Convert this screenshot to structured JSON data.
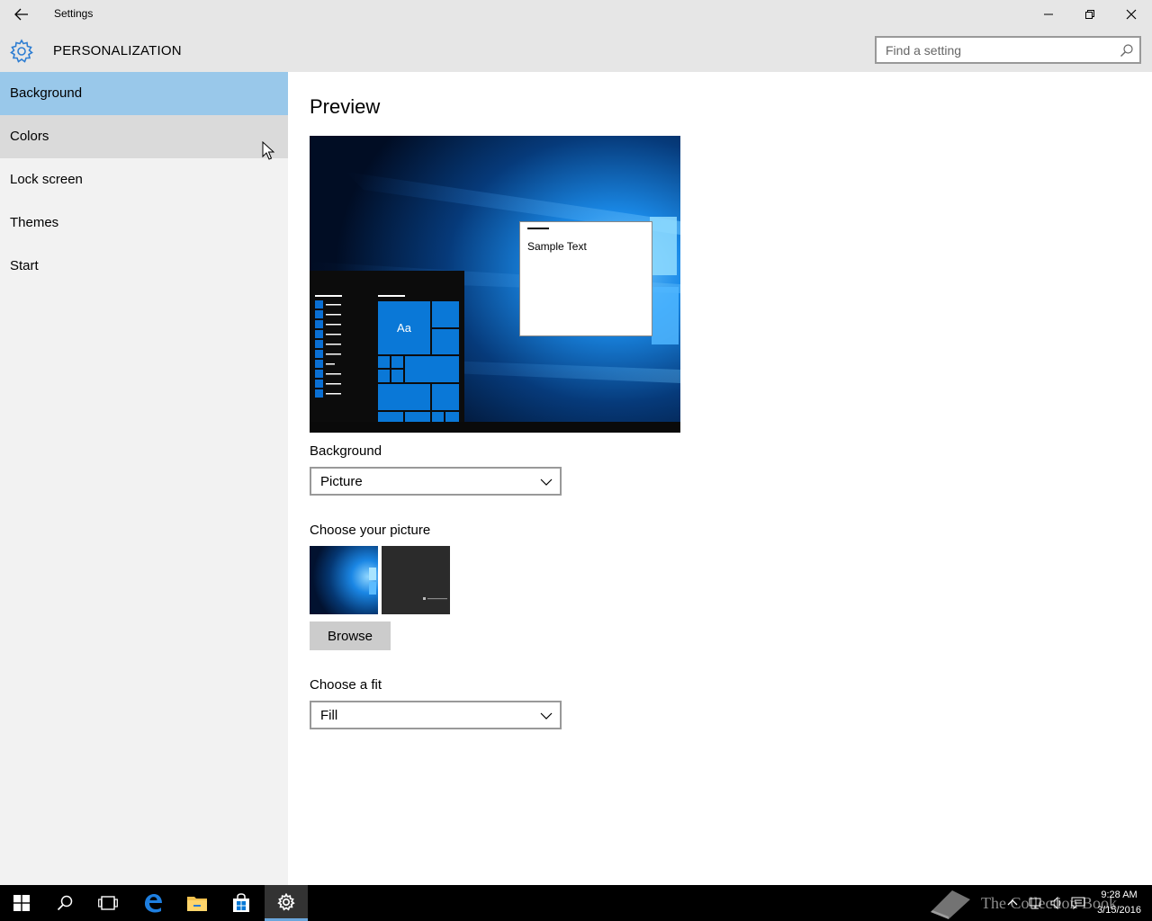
{
  "window": {
    "title": "Settings",
    "section_title": "PERSONALIZATION"
  },
  "search": {
    "placeholder": "Find a setting"
  },
  "sidebar": {
    "items": [
      {
        "label": "Background",
        "state": "selected"
      },
      {
        "label": "Colors",
        "state": "hover"
      },
      {
        "label": "Lock screen",
        "state": "normal"
      },
      {
        "label": "Themes",
        "state": "normal"
      },
      {
        "label": "Start",
        "state": "normal"
      }
    ]
  },
  "main": {
    "preview_heading": "Preview",
    "preview": {
      "sample_text": "Sample Text",
      "tile_label": "Aa"
    },
    "background_label": "Background",
    "background_value": "Picture",
    "choose_picture_label": "Choose your picture",
    "browse_label": "Browse",
    "choose_fit_label": "Choose a fit",
    "fit_value": "Fill"
  },
  "taskbar": {
    "clock_time": "9:28 AM",
    "clock_date": "3/15/2016",
    "watermark": "The Collection Book"
  },
  "colors": {
    "accent": "#0078d7",
    "selected_nav": "#99c8ea",
    "hover_nav": "#dadada"
  }
}
